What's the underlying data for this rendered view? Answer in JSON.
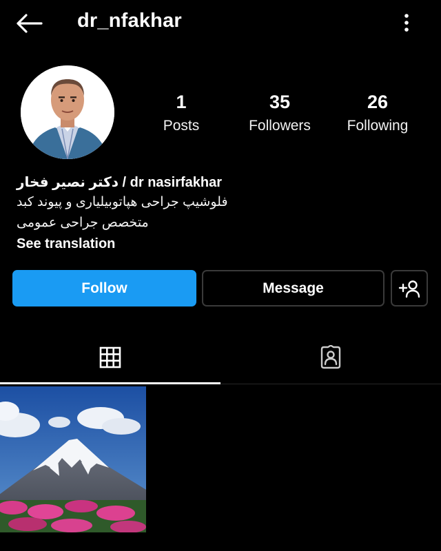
{
  "header": {
    "username": "dr_nfakhar",
    "back_icon": "arrow-left-icon",
    "more_icon": "vertical-ellipsis-icon"
  },
  "profile": {
    "avatar": "profile-photo",
    "stats": {
      "posts": {
        "count": "1",
        "label": "Posts"
      },
      "followers": {
        "count": "35",
        "label": "Followers"
      },
      "following": {
        "count": "26",
        "label": "Following"
      }
    }
  },
  "bio": {
    "name": "دکتر نصیر فخار / dr nasirfakhar",
    "line1": "فلوشیپ جراحی هپاتوبیلیاری و پیوند کبد",
    "line2": "متخصص جراحی عمومی",
    "translate": "See translation"
  },
  "actions": {
    "follow": "Follow",
    "message": "Message",
    "add_user_icon": "add-person-icon"
  },
  "tabs": [
    {
      "icon": "grid-icon",
      "active": true
    },
    {
      "icon": "tagged-person-icon",
      "active": false
    }
  ],
  "colors": {
    "background": "#000000",
    "accent": "#1a9bf3",
    "text": "#ffffff",
    "border": "#3a3a3a"
  },
  "posts": [
    {
      "thumbnail": "mountain-landscape-photo"
    }
  ]
}
